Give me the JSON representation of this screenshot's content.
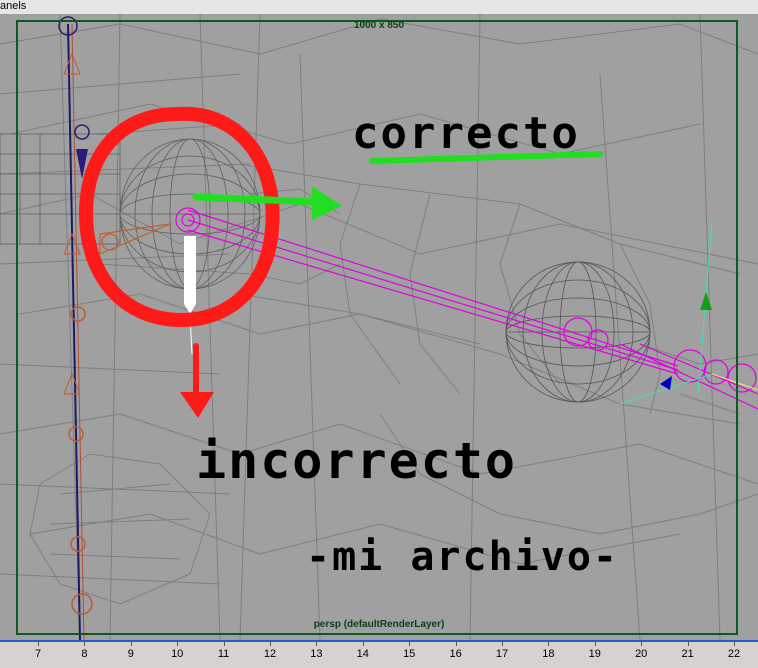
{
  "menubar": {
    "label": "anels"
  },
  "viewport": {
    "resolution_label": "1000 x 850",
    "camera_label": "persp (defaultRenderLayer)"
  },
  "annotations": {
    "correct": "correcto",
    "incorrect": "incorrecto",
    "file_note": "-mi archivo-"
  },
  "timeline": {
    "ticks": [
      "7",
      "8",
      "9",
      "10",
      "11",
      "12",
      "13",
      "14",
      "15",
      "16",
      "17",
      "18",
      "19",
      "20",
      "21",
      "22"
    ]
  },
  "colors": {
    "viewport_bg": "#a0a0a0",
    "wireframe": "#7a7a7a",
    "joint_selected": "#e000e0",
    "circle_annotation": "#ff1a1a",
    "arrow_green": "#22dd22",
    "arrow_red": "#ff1a1a",
    "frame_border": "#0b5a1f",
    "timeline_accent": "#2a5bd0"
  }
}
